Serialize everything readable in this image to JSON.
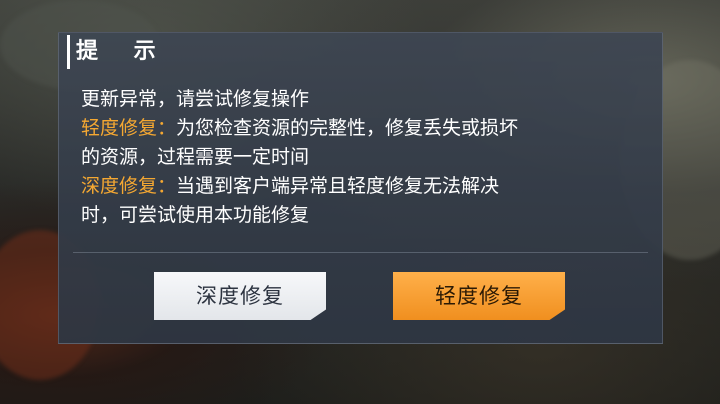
{
  "dialog": {
    "title": "提 示",
    "intro": "更新异常，请尝试修复操作",
    "light_repair": {
      "label": "轻度修复：",
      "desc_line1": "为您检查资源的完整性，修复丢失或损坏",
      "desc_line2": "的资源，过程需要一定时间"
    },
    "deep_repair": {
      "label": "深度修复：",
      "desc_line1": "当遇到客户端异常且轻度修复无法解决",
      "desc_line2": "时，可尝试使用本功能修复"
    },
    "buttons": {
      "deep_label": "深度修复",
      "light_label": "轻度修复"
    }
  },
  "colors": {
    "highlight": "#f5a832",
    "primary_button": "#f5a03a",
    "secondary_button": "#eceef1"
  }
}
